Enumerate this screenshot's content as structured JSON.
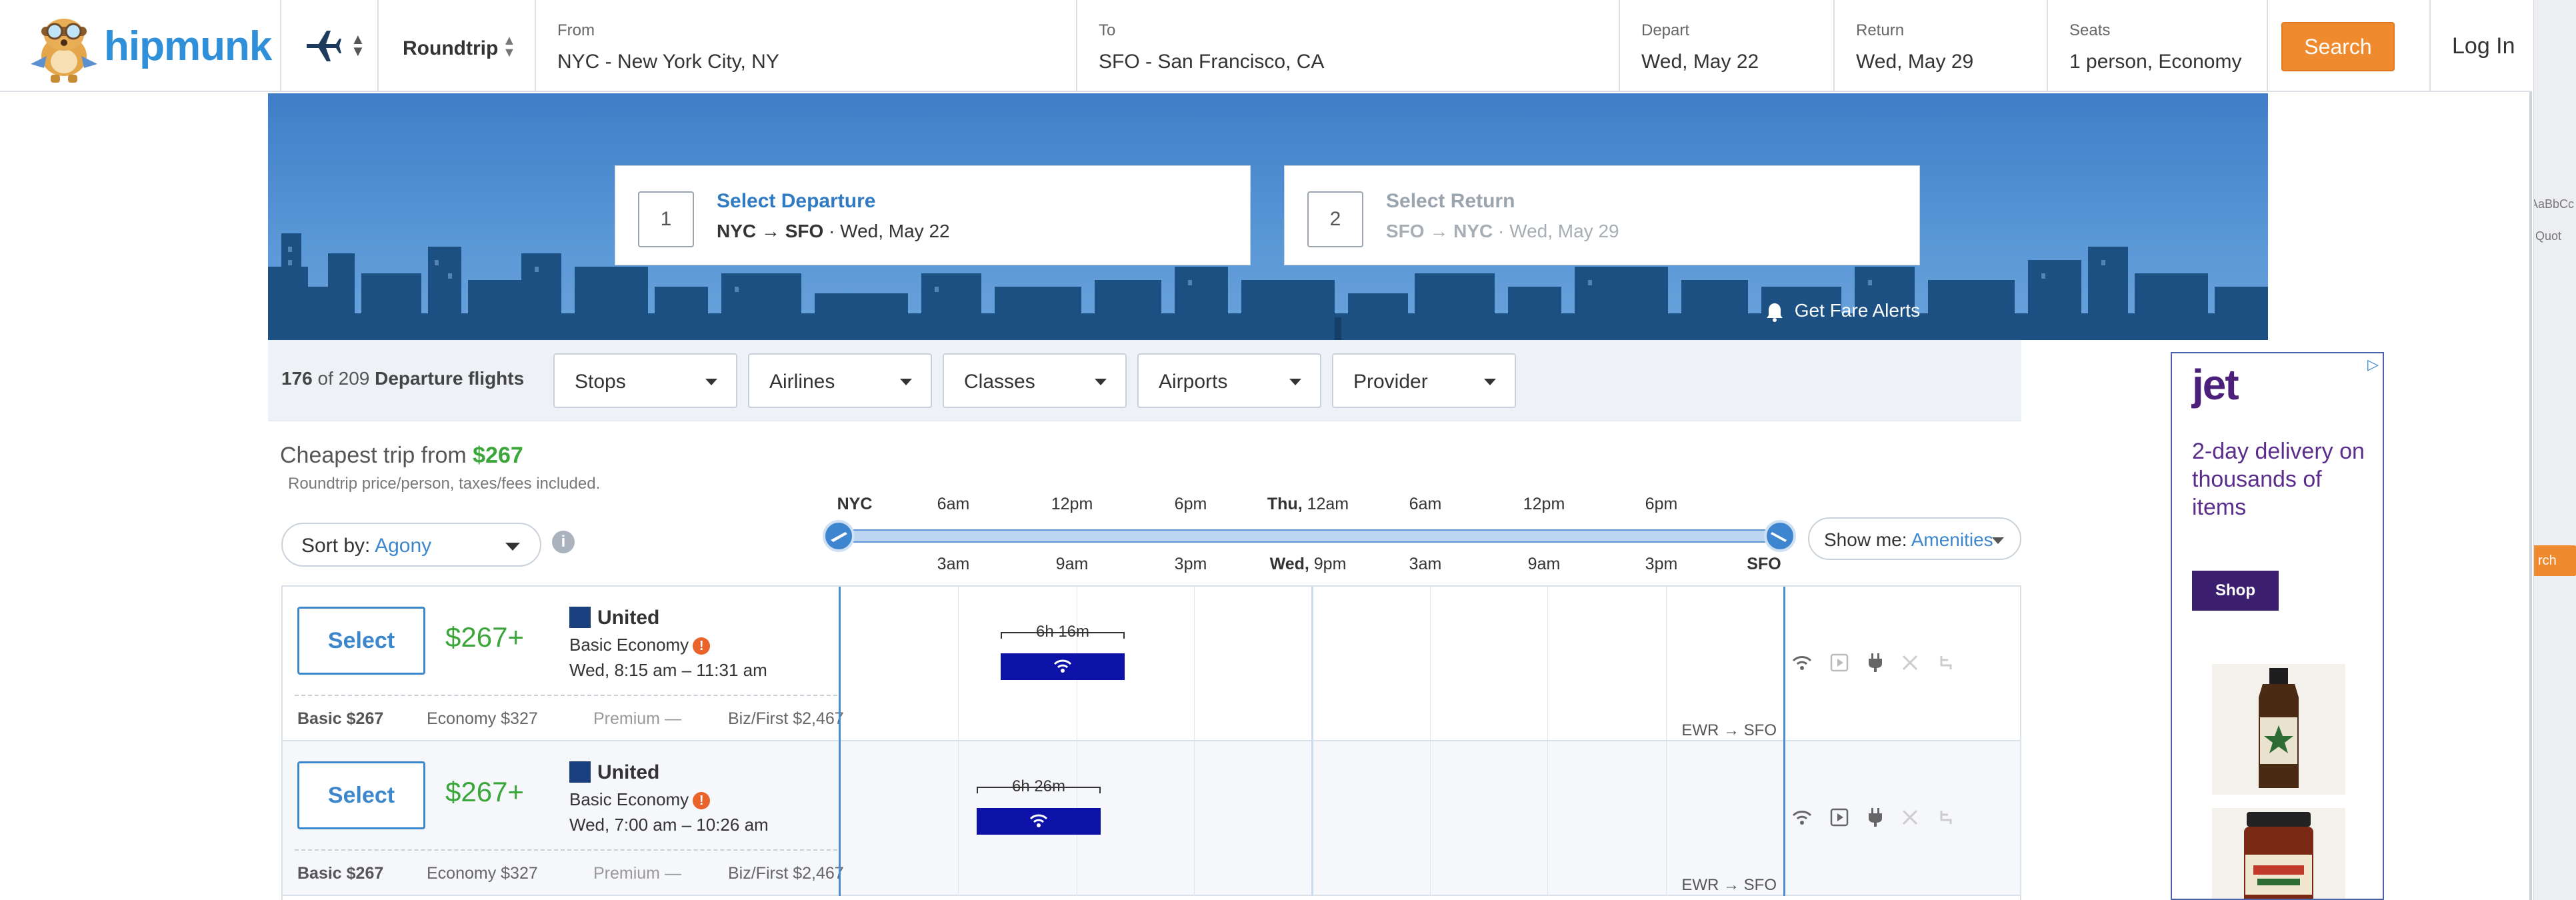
{
  "header": {
    "logo_text": "hipmunk",
    "trip_type": "Roundtrip",
    "from_label": "From",
    "from_value": "NYC - New York City, NY",
    "to_label": "To",
    "to_value": "SFO - San Francisco, CA",
    "depart_label": "Depart",
    "depart_value": "Wed, May 22",
    "return_label": "Return",
    "return_value": "Wed, May 29",
    "seats_label": "Seats",
    "seats_value": "1 person, Economy",
    "search_label": "Search",
    "login_label": "Log In"
  },
  "steps": [
    {
      "num": "1",
      "title": "Select Departure",
      "from": "NYC",
      "to": "SFO",
      "date": "Wed, May 22"
    },
    {
      "num": "2",
      "title": "Select Return",
      "from": "SFO",
      "to": "NYC",
      "date": "Wed, May 29"
    }
  ],
  "fare_alerts": "Get Fare Alerts",
  "filters": {
    "count": "176",
    "of_text": "of 209",
    "label": "Departure flights",
    "items": [
      "Stops",
      "Airlines",
      "Classes",
      "Airports",
      "Provider"
    ]
  },
  "cheapest": {
    "prefix": "Cheapest trip from",
    "price": "$267",
    "note": "Roundtrip price/person, taxes/fees included."
  },
  "sort": {
    "label": "Sort by:",
    "value": "Agony"
  },
  "show_me": {
    "label": "Show me:",
    "value": "Amenities"
  },
  "timeline": {
    "top": [
      {
        "bold": "NYC",
        "text": ""
      },
      {
        "bold": "",
        "text": "6am"
      },
      {
        "bold": "",
        "text": "12pm"
      },
      {
        "bold": "",
        "text": "6pm"
      },
      {
        "bold": "Thu,",
        "text": " 12am"
      },
      {
        "bold": "",
        "text": "6am"
      },
      {
        "bold": "",
        "text": "12pm"
      },
      {
        "bold": "",
        "text": "6pm"
      }
    ],
    "bottom": [
      {
        "bold": "",
        "text": "3am"
      },
      {
        "bold": "",
        "text": "9am"
      },
      {
        "bold": "",
        "text": "3pm"
      },
      {
        "bold": "Wed,",
        "text": " 9pm"
      },
      {
        "bold": "",
        "text": "3am"
      },
      {
        "bold": "",
        "text": "9am"
      },
      {
        "bold": "",
        "text": "3pm"
      },
      {
        "bold": "SFO",
        "text": ""
      }
    ]
  },
  "flights": [
    {
      "select": "Select",
      "price": "$267+",
      "airline": "United",
      "fare_class": "Basic Economy",
      "times": "Wed, 8:15 am – 11:31 am",
      "duration": "6h 16m",
      "airports": "EWR → SFO",
      "fares": {
        "basic": "Basic $267",
        "economy": "Economy $327",
        "premium": "Premium  —",
        "biz": "Biz/First $2,467"
      },
      "amenities": [
        "wifi-icon",
        "video-icon",
        "power-icon",
        "food-icon",
        "legroom-icon"
      ]
    },
    {
      "select": "Select",
      "price": "$267+",
      "airline": "United",
      "fare_class": "Basic Economy",
      "times": "Wed, 7:00 am – 10:26 am",
      "duration": "6h 26m",
      "airports": "EWR → SFO",
      "fares": {
        "basic": "Basic $267",
        "economy": "Economy $327",
        "premium": "Premium  —",
        "biz": "Biz/First $2,467"
      },
      "amenities": [
        "wifi-icon",
        "video-icon",
        "power-icon",
        "food-icon",
        "legroom-icon"
      ]
    }
  ],
  "ad": {
    "flag": "▷",
    "brand": "jet",
    "copy": "2-day delivery on thousands of items",
    "shop": "Shop"
  },
  "side_window": {
    "text1": "AaBbCc",
    "text2": "Quot",
    "button": "rch"
  }
}
